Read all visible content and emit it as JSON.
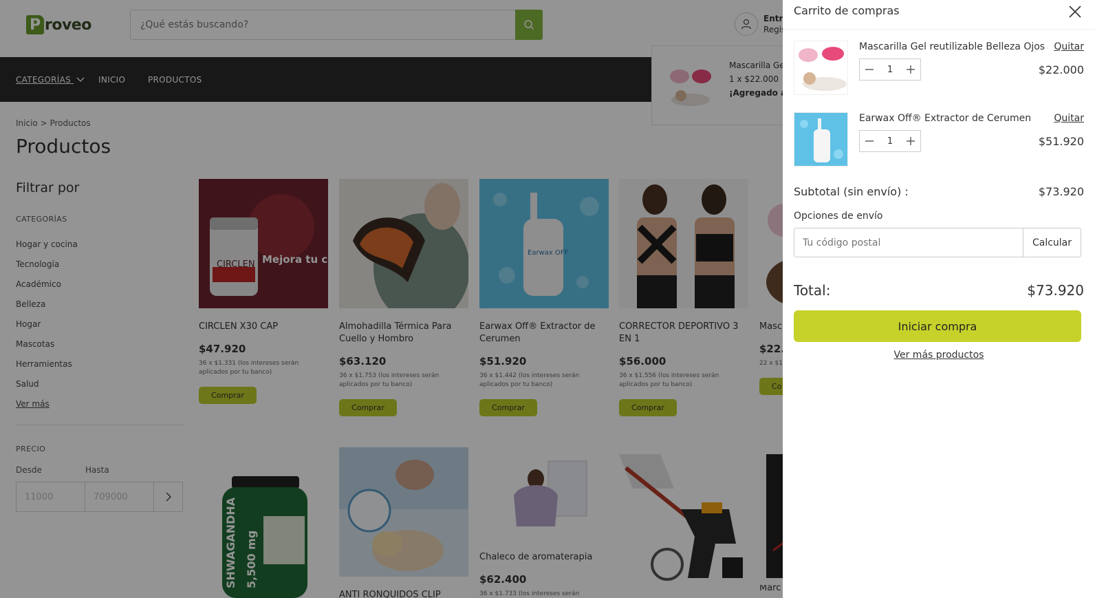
{
  "header": {
    "logo_initial": "P",
    "logo_rest": "roveo",
    "search_placeholder": "¿Qué estás buscando?",
    "account_line1": "Entra",
    "account_line2": "Regis"
  },
  "nav": {
    "categories": "CATEGORÍAS",
    "home": "INICIO",
    "products": "PRODUCTOS"
  },
  "added_popup": {
    "name": "Mascarilla Gel",
    "qty_price": "1 x $22.000",
    "status": "¡Agregado al"
  },
  "breadcrumb": {
    "home": "Inicio",
    "sep": ">",
    "current": "Productos"
  },
  "page_title": "Productos",
  "filters": {
    "title": "Filtrar por",
    "categories_heading": "CATEGORÍAS",
    "categories": [
      "Hogar y cocina",
      "Tecnología",
      "Académico",
      "Belleza",
      "Hogar",
      "Mascotas",
      "Herramientas",
      "Salud"
    ],
    "see_more": "Ver más",
    "price_heading": "PRECIO",
    "from_label": "Desde",
    "to_label": "Hasta",
    "from_placeholder": "11000",
    "to_placeholder": "709000"
  },
  "products_row1": [
    {
      "name": "CIRCLEN X30 CAP",
      "price": "$47.920",
      "installments": "36 x $1.331 (los intereses serán aplicados por tu banco)",
      "buy": "Comprar"
    },
    {
      "name": "Almohadilla Térmica Para Cuello y Hombro",
      "price": "$63.120",
      "installments": "36 x $1.753 (los intereses serán aplicados por tu banco)",
      "buy": "Comprar"
    },
    {
      "name": "Earwax Off® Extractor de Cerumen",
      "price": "$51.920",
      "installments": "36 x $1.442 (los intereses serán aplicados por tu banco)",
      "buy": "Comprar"
    },
    {
      "name": "CORRECTOR DEPORTIVO 3 EN 1",
      "price": "$56.000",
      "installments": "36 x $1.556 (los intereses serán aplicados por tu banco)",
      "buy": "Comprar"
    },
    {
      "name": "Masc Bellez",
      "price": "$22.",
      "installments": "22 x $1. aplicad",
      "buy": "Co"
    }
  ],
  "products_row2": [
    {
      "name": "",
      "price": "",
      "installments": ""
    },
    {
      "name": "ANTI RONQUIDOS CLIP",
      "price": "",
      "installments": ""
    },
    {
      "name": "Chaleco de aromaterapia",
      "price": "$62.400",
      "installments": "36 x $1.733 (los intereses serán aplicados por tu banco)"
    },
    {
      "name": "",
      "price": "",
      "installments": ""
    },
    {
      "name": "Marc",
      "price": "",
      "installments": ""
    }
  ],
  "product_image_text": {
    "circlen_headline": "Mejora tu circulación",
    "circlen_brand": "CIRCLEN",
    "earwax_brand": "Earwax OFF",
    "ashwa_brand": "SHWAGANDHA",
    "ashwa_dose": "5,500 mg"
  },
  "cart": {
    "title": "Carrito de compras",
    "remove_label": "Quitar",
    "items": [
      {
        "name": "Mascarilla Gel reutilizable Belleza Ojos",
        "qty": "1",
        "price": "$22.000"
      },
      {
        "name": "Earwax Off® Extractor de Cerumen",
        "qty": "1",
        "price": "$51.920"
      }
    ],
    "subtotal_label": "Subtotal (sin envío) :",
    "subtotal": "$73.920",
    "shipping_label": "Opciones de envío",
    "zip_placeholder": "Tu código postal",
    "calc_label": "Calcular",
    "total_label": "Total:",
    "total": "$73.920",
    "checkout_label": "Iniciar compra",
    "more_label": "Ver más productos"
  },
  "colors": {
    "brand_green": "#86b740",
    "buy_button": "#bccc2a",
    "checkout_button": "#c6d22a",
    "nav_bg": "#2a2a2a"
  }
}
